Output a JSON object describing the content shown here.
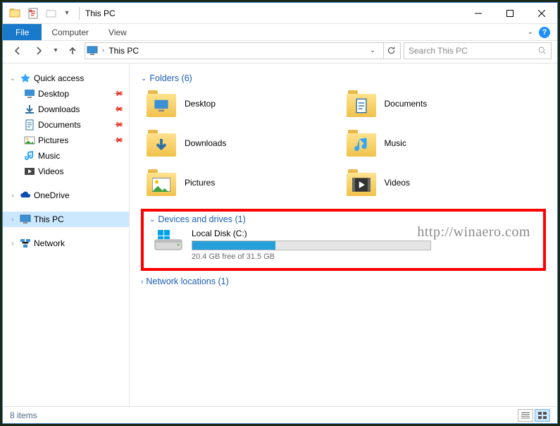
{
  "window": {
    "title": "This PC"
  },
  "ribbon": {
    "file": "File",
    "tabs": [
      "Computer",
      "View"
    ]
  },
  "address": {
    "location": "This PC",
    "search_placeholder": "Search This PC"
  },
  "nav": {
    "quick_access": {
      "label": "Quick access",
      "items": [
        {
          "label": "Desktop",
          "pinned": true,
          "icon": "desktop"
        },
        {
          "label": "Downloads",
          "pinned": true,
          "icon": "download"
        },
        {
          "label": "Documents",
          "pinned": true,
          "icon": "doc"
        },
        {
          "label": "Pictures",
          "pinned": true,
          "icon": "pic"
        },
        {
          "label": "Music",
          "pinned": false,
          "icon": "music"
        },
        {
          "label": "Videos",
          "pinned": false,
          "icon": "video"
        }
      ]
    },
    "onedrive": "OneDrive",
    "this_pc": "This PC",
    "network": "Network"
  },
  "content": {
    "folders": {
      "header": "Folders (6)",
      "items": [
        {
          "label": "Desktop",
          "badge": "desktop"
        },
        {
          "label": "Documents",
          "badge": "doc"
        },
        {
          "label": "Downloads",
          "badge": "download"
        },
        {
          "label": "Music",
          "badge": "music"
        },
        {
          "label": "Pictures",
          "badge": "pic"
        },
        {
          "label": "Videos",
          "badge": "video"
        }
      ]
    },
    "drives": {
      "header": "Devices and drives (1)",
      "items": [
        {
          "label": "Local Disk (C:)",
          "sub": "20.4 GB free of 31.5 GB",
          "fill_pct": 35
        }
      ]
    },
    "netloc": {
      "header": "Network locations (1)"
    }
  },
  "watermark": "http://winaero.com",
  "status": {
    "count": "8 items"
  }
}
